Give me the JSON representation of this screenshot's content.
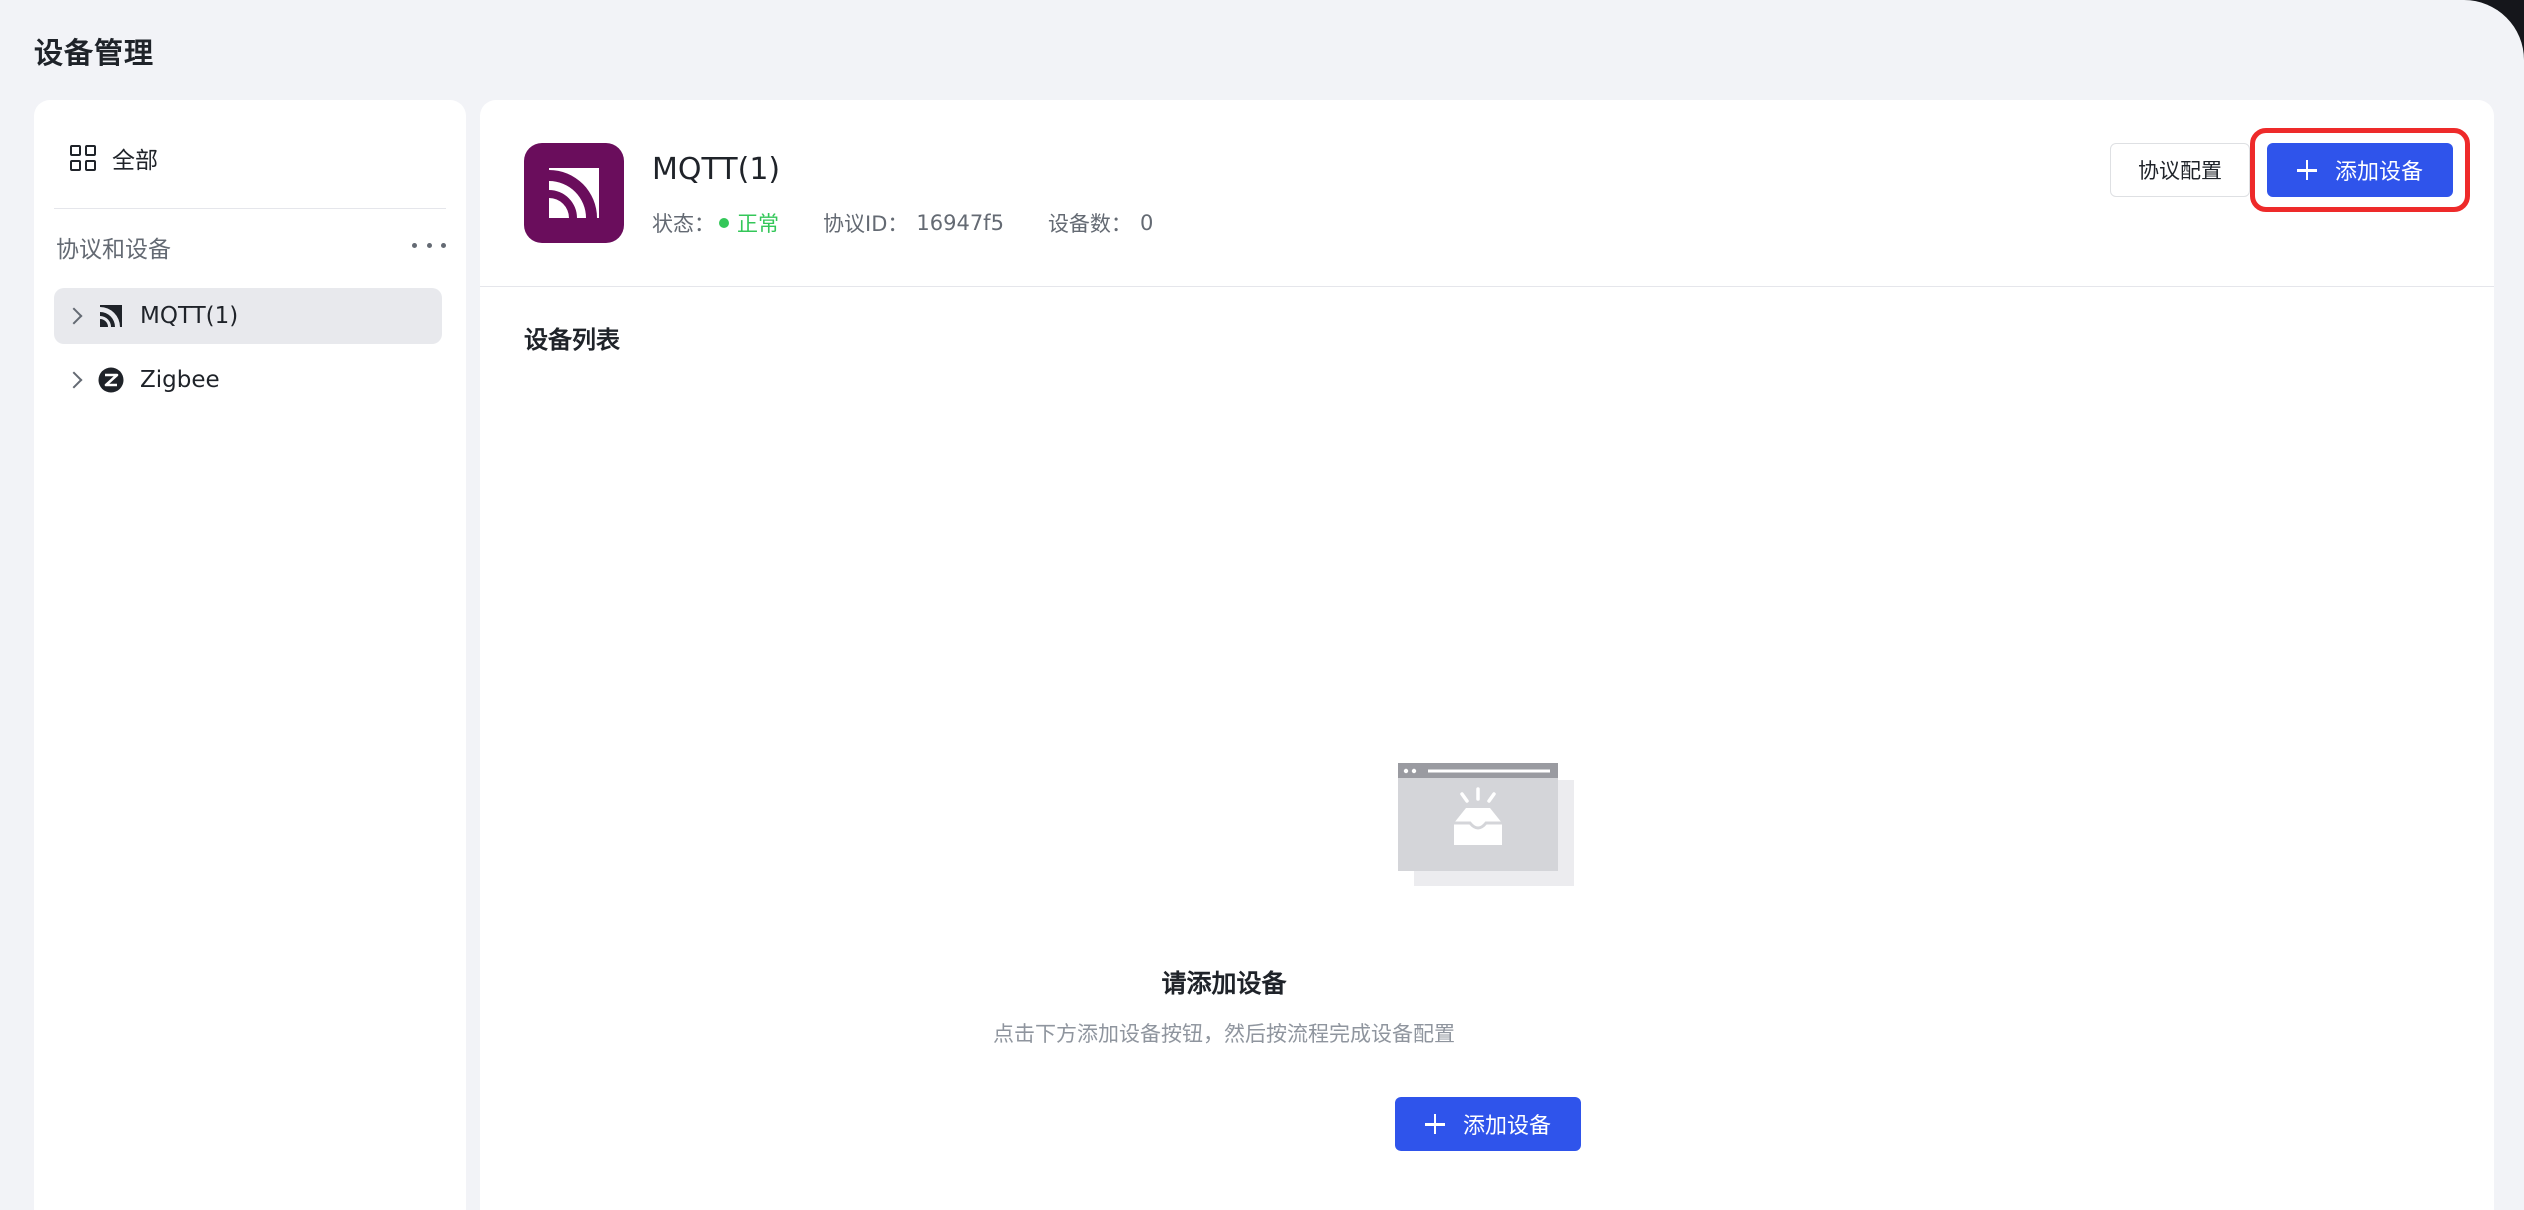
{
  "page": {
    "title": "设备管理"
  },
  "sidebar": {
    "all_label": "全部",
    "section_title": "协议和设备",
    "items": [
      {
        "label": "MQTT(1)",
        "icon": "mqtt-icon",
        "active": true
      },
      {
        "label": "Zigbee",
        "icon": "zigbee-icon",
        "active": false
      }
    ]
  },
  "header": {
    "title": "MQTT(1)",
    "status_label": "状态：",
    "status_value": "正常",
    "protocol_id_label": "协议ID：",
    "protocol_id_value": "16947f5",
    "device_count_label": "设备数：",
    "device_count_value": "0",
    "config_button": "协议配置",
    "add_button": "添加设备"
  },
  "device_list": {
    "title": "设备列表",
    "empty_title": "请添加设备",
    "empty_desc": "点击下方添加设备按钮，然后按流程完成设备配置",
    "add_button": "添加设备"
  },
  "colors": {
    "primary": "#2f54eb",
    "status_ok": "#34c759",
    "highlight": "#ee2a2a",
    "mqtt_brand": "#6a0d5c"
  }
}
